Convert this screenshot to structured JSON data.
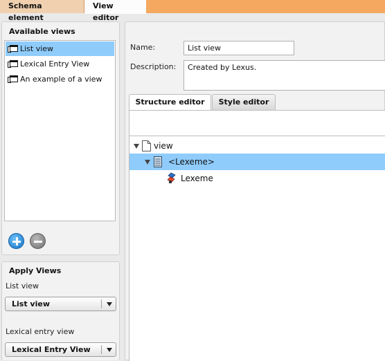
{
  "top_tabs": [
    {
      "label": "Schema element"
    },
    {
      "label": "View editor"
    }
  ],
  "available_views": {
    "title": "Available views",
    "items": [
      {
        "label": "List view",
        "selected": true,
        "icon": "view-icon"
      },
      {
        "label": "Lexical Entry View",
        "selected": false,
        "icon": "view-icon"
      },
      {
        "label": "An example of a view",
        "selected": false,
        "icon": "view-icon"
      }
    ],
    "add_icon": "plus-circle-icon",
    "remove_icon": "minus-circle-icon"
  },
  "apply_views": {
    "title": "Apply Views",
    "groups": [
      {
        "label": "List view",
        "selected": "List view"
      },
      {
        "label": "Lexical entry view",
        "selected": "Lexical Entry View"
      }
    ]
  },
  "editor": {
    "name_label": "Name:",
    "name_value": "List view",
    "description_label": "Description:",
    "description_value": "Created by Lexus.",
    "tabs": [
      {
        "label": "Structure editor",
        "active": true
      },
      {
        "label": "Style editor",
        "active": false
      }
    ],
    "tree": [
      {
        "label": "view",
        "icon": "document-icon",
        "expanded": true,
        "selected": false
      },
      {
        "label": "<Lexeme>",
        "icon": "schema-element-icon",
        "expanded": true,
        "selected": true
      },
      {
        "label": "Lexeme",
        "icon": "data-field-icon",
        "expanded": false,
        "selected": false
      }
    ]
  },
  "colors": {
    "top_bar": "#f5a860",
    "selection": "#8fccfb",
    "add_button": "#1675c8"
  }
}
